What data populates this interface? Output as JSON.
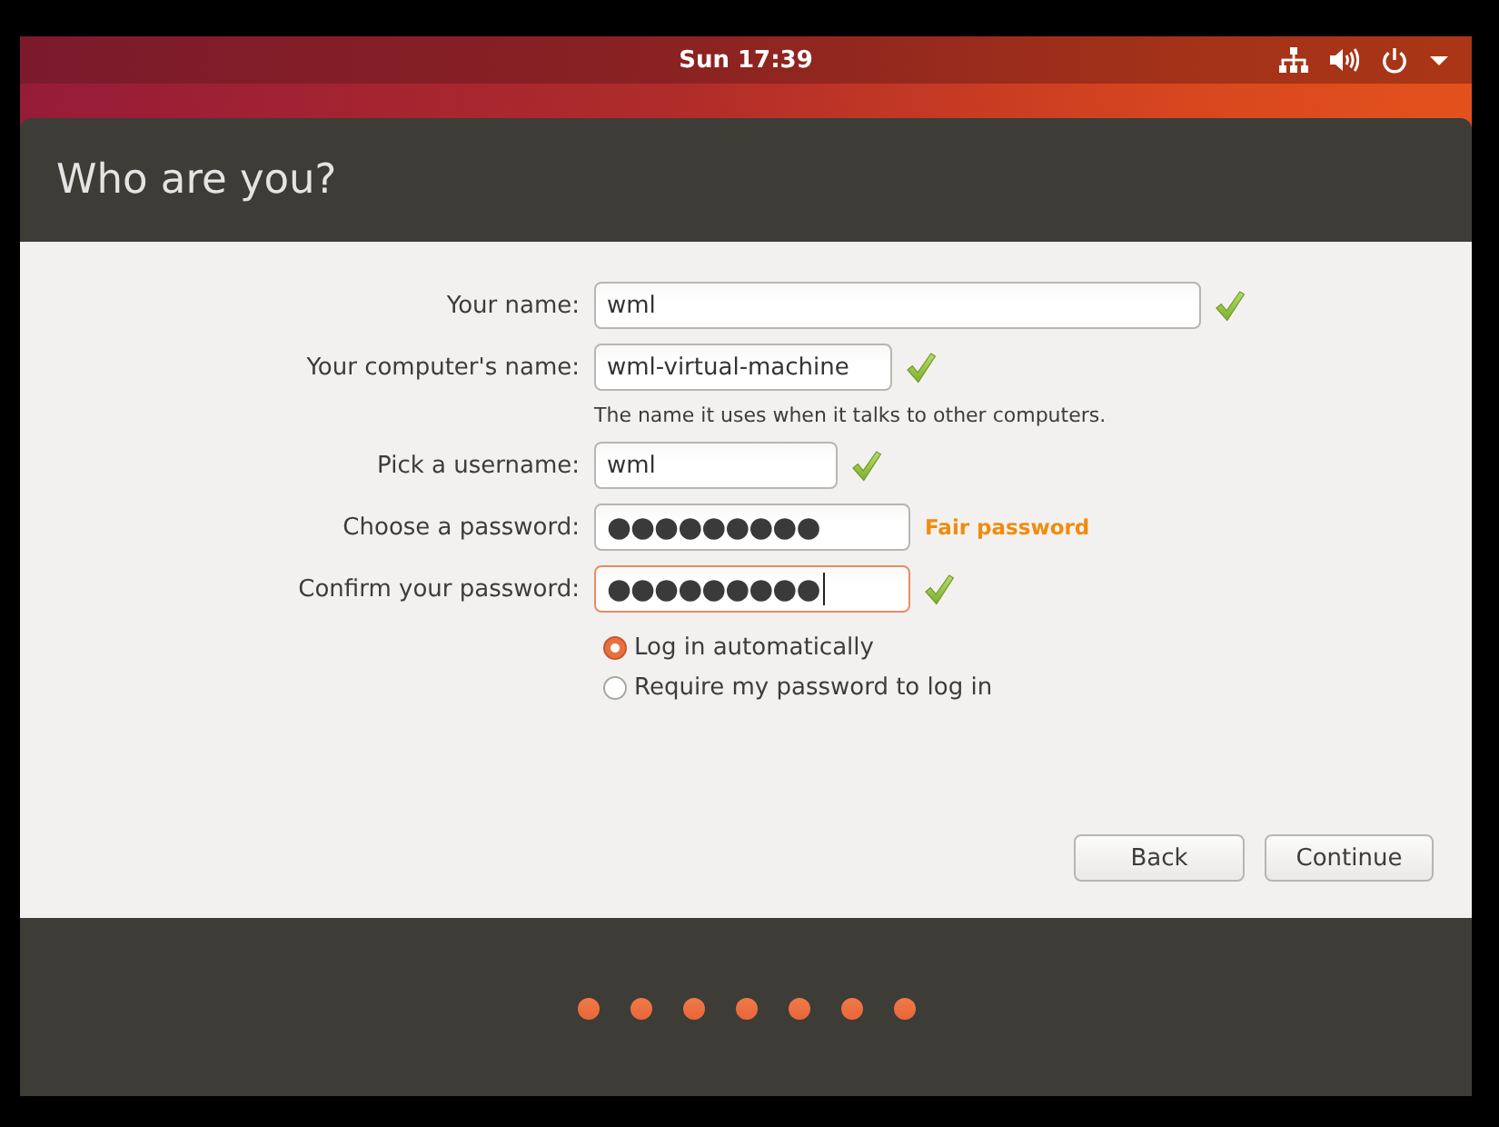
{
  "top_bar": {
    "clock": "Sun 17:39"
  },
  "window": {
    "title": "Who are you?"
  },
  "form": {
    "fields": [
      {
        "label": "Your name:",
        "value": "wml",
        "valid": true,
        "focused": false
      },
      {
        "label": "Your computer's name:",
        "value": "wml-virtual-machine",
        "hint": "The name it uses when it talks to other computers.",
        "valid": true,
        "focused": false
      },
      {
        "label": "Pick a username:",
        "value": "wml",
        "valid": true,
        "focused": false
      },
      {
        "label": "Choose a password:",
        "value": "●●●●●●●●●",
        "valid": false,
        "strength": "Fair password",
        "focused": false
      },
      {
        "label": "Confirm your password:",
        "value": "●●●●●●●●●",
        "valid": true,
        "focused": true
      }
    ],
    "login_options": [
      {
        "label": "Log in automatically",
        "selected": true
      },
      {
        "label": "Require my password to log in",
        "selected": false
      }
    ]
  },
  "buttons": [
    {
      "label": "Back"
    },
    {
      "label": "Continue"
    }
  ]
}
